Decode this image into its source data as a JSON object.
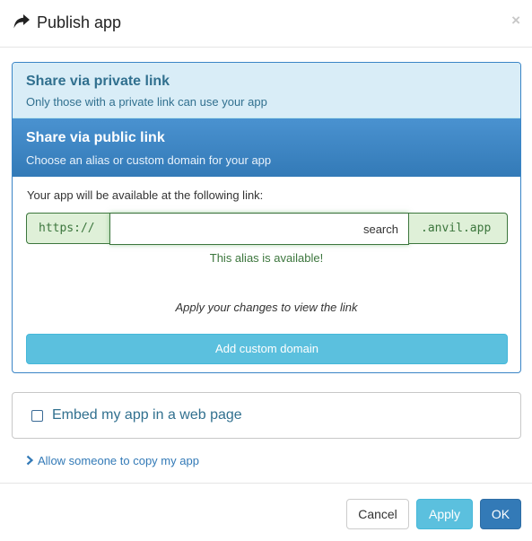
{
  "header": {
    "title": "Publish app",
    "icon": "share-icon",
    "close_label": "×"
  },
  "private_link": {
    "title": "Share via private link",
    "subtitle": "Only those with a private link can use your app"
  },
  "public_link": {
    "title": "Share via public link",
    "subtitle": "Choose an alias or custom domain for your app",
    "availability_label": "Your app will be available at the following link:",
    "prefix": "https://",
    "alias_value": "search",
    "suffix": ".anvil.app",
    "status": "This alias is available!",
    "apply_note": "Apply your changes to view the link",
    "custom_domain_button": "Add custom domain"
  },
  "embed": {
    "label": "Embed my app in a web page",
    "checked": false
  },
  "copy_link": {
    "label": "Allow someone to copy my app",
    "icon": "chevron-right-icon"
  },
  "footer": {
    "cancel_label": "Cancel",
    "apply_label": "Apply",
    "ok_label": "OK"
  },
  "colors": {
    "primary": "#337ab7",
    "info": "#5bc0de",
    "success": "#3c763d",
    "success_bg": "#dff0d8",
    "info_bg": "#d9edf7"
  }
}
